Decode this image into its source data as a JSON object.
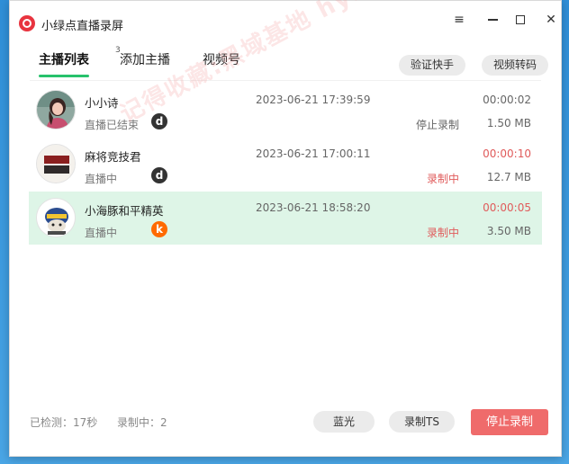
{
  "window": {
    "title": "小绿点直播录屏",
    "controls": {
      "menu": "≡",
      "close": "✕"
    }
  },
  "tabs": {
    "list_label": "主播列表",
    "list_badge": "3",
    "add_label": "添加主播",
    "video_label": "视频号"
  },
  "toolbar": {
    "verify_label": "验证快手",
    "convert_label": "视频转码"
  },
  "rows": [
    {
      "name": "小小诗",
      "status": "直播已结束",
      "platform": "d",
      "time": "2023-06-21 17:39:59",
      "action": "停止录制",
      "duration": "00:00:02",
      "size": "1.50 MB",
      "avatar_icon": "woman-photo-avatar"
    },
    {
      "name": "麻将竞技君",
      "status": "直播中",
      "platform": "d",
      "time": "2023-06-21 17:00:11",
      "action": "录制中",
      "duration": "00:00:10",
      "size": "12.7 MB",
      "avatar_icon": "mahjong-logo-avatar",
      "avatar_text": "麻将竞技君"
    },
    {
      "name": "小海豚和平精英",
      "status": "直播中",
      "platform": "k",
      "time": "2023-06-21 18:58:20",
      "action": "录制中",
      "duration": "00:00:05",
      "size": "3.50 MB",
      "avatar_icon": "cartoon-character-avatar"
    }
  ],
  "footer": {
    "checked": "已检测：17秒",
    "recording": "录制中：2",
    "bluray_label": "蓝光",
    "ts_label": "录制TS",
    "stop_label": "停止录制"
  },
  "watermark": "记得收藏:黑域基地 hybase.com",
  "colors": {
    "accent_green": "#27c26c",
    "highlight_row": "#def5e7",
    "recording_red": "#e05b5b",
    "stop_button": "#ef6b6b",
    "app_icon_red": "#e8343f"
  }
}
